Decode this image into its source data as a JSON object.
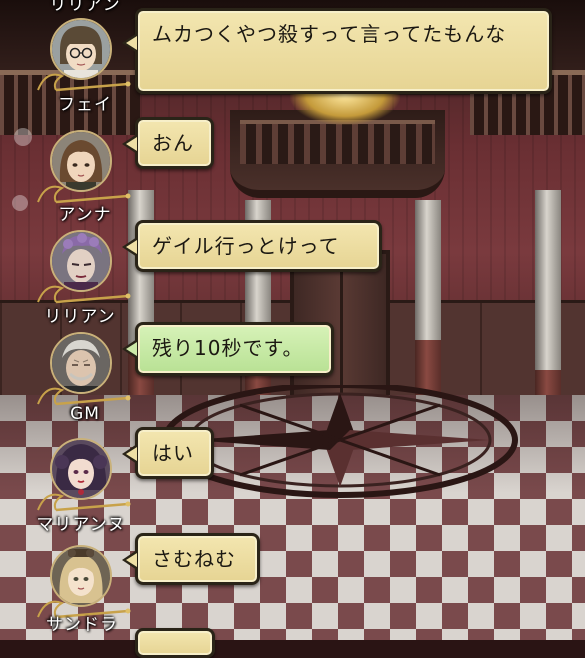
{
  "chat": {
    "partial_top_name": "リリアン",
    "messages": [
      {
        "speaker": "フェイ",
        "text": "ムカつくやつ殺すって言ってたもんな",
        "style": "normal"
      },
      {
        "speaker": "アンナ",
        "text": "おん",
        "style": "normal"
      },
      {
        "speaker": "リリアン",
        "text": "ゲイル行っとけって",
        "style": "normal"
      },
      {
        "speaker": "GM",
        "text": "残り10秒です。",
        "style": "system"
      },
      {
        "speaker": "マリアンヌ",
        "text": "はい",
        "style": "normal"
      },
      {
        "speaker": "サンドラ",
        "text": "さむねむ",
        "style": "normal"
      }
    ]
  },
  "colors": {
    "bubble_normal": "#f3e6b0",
    "bubble_system": "#c9eaa6",
    "bubble_border": "#2a2418",
    "name_text": "#ffffff",
    "wall": "#6a2f33",
    "floor_dark": "#7a4a4c",
    "floor_light": "#d9d4cf"
  },
  "icons": {
    "name_flourish": "gold-vine-flourish-icon"
  }
}
